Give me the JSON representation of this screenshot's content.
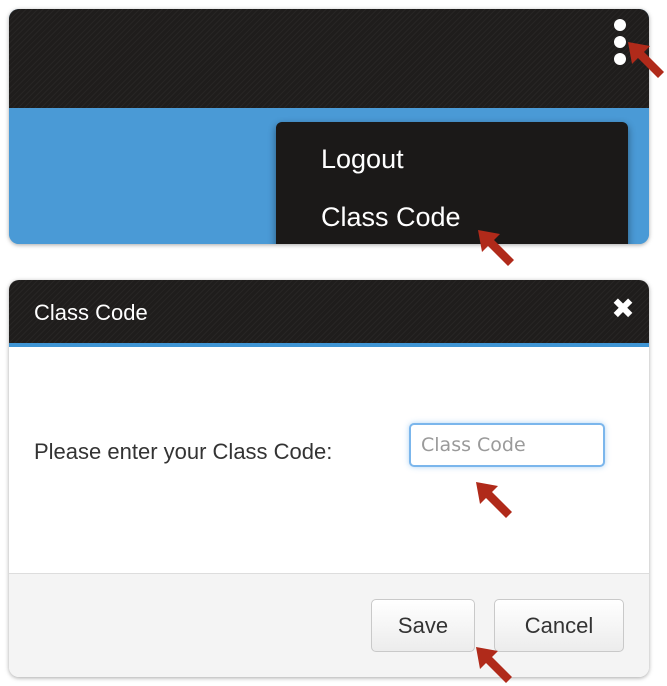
{
  "top_panel": {
    "menu_items": [
      {
        "label": "Logout"
      },
      {
        "label": "Class Code"
      }
    ]
  },
  "modal": {
    "title": "Class Code",
    "close_icon": "close-icon",
    "prompt": "Please enter your Class Code:",
    "input": {
      "value": "",
      "placeholder": "Class Code"
    },
    "buttons": {
      "save": "Save",
      "cancel": "Cancel"
    }
  },
  "icons": {
    "menu": "kebab-menu-icon",
    "annotation": "arrow-pointer-icon"
  },
  "colors": {
    "header_dark": "#1f1d1c",
    "accent_blue": "#4a9ad6",
    "annotation_red": "#b02a1a"
  }
}
